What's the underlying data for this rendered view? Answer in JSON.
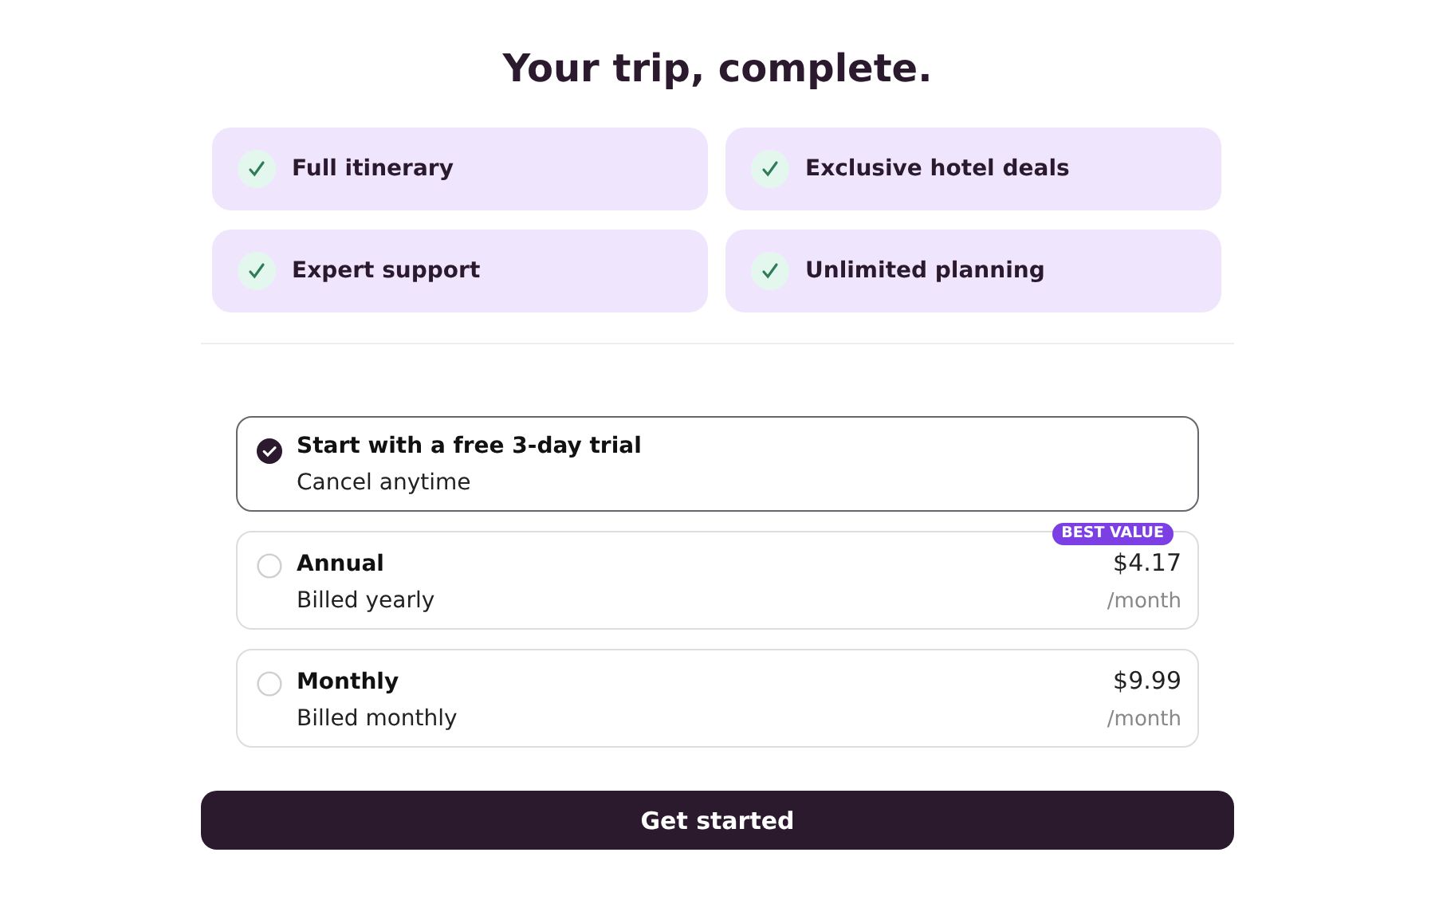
{
  "title": "Your trip, complete.",
  "features": [
    {
      "label": "Full itinerary"
    },
    {
      "label": "Exclusive hotel deals"
    },
    {
      "label": "Expert support"
    },
    {
      "label": "Unlimited planning"
    }
  ],
  "plans": [
    {
      "name": "Start with a free 3-day trial",
      "note": "Cancel anytime",
      "selected": true
    },
    {
      "name": "Annual",
      "note": "Billed yearly",
      "price": "$4.17",
      "period": "/month",
      "badge": "BEST VALUE",
      "selected": false
    },
    {
      "name": "Monthly",
      "note": "Billed monthly",
      "price": "$9.99",
      "period": "/month",
      "selected": false
    }
  ],
  "button": "Get started"
}
